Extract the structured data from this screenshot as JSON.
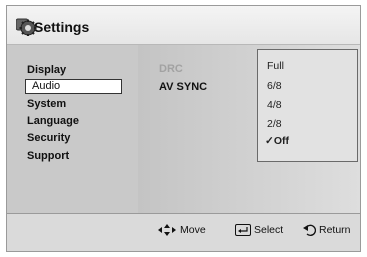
{
  "header": {
    "title": "Settings",
    "icon": "settings-gear-icon"
  },
  "sidebar": {
    "items": [
      {
        "label": "Display"
      },
      {
        "label": "Audio",
        "selected": true
      },
      {
        "label": "System"
      },
      {
        "label": "Language"
      },
      {
        "label": "Security"
      },
      {
        "label": "Support"
      }
    ]
  },
  "main": {
    "settings": [
      {
        "label": "DRC",
        "disabled": true
      },
      {
        "label": "AV SYNC"
      }
    ]
  },
  "popup": {
    "options": [
      "Full",
      "6/8",
      "4/8",
      "2/8",
      "Off"
    ],
    "checked": "Off",
    "check_mark": "✓"
  },
  "footer": {
    "move": "Move",
    "select": "Select",
    "return": "Return"
  }
}
